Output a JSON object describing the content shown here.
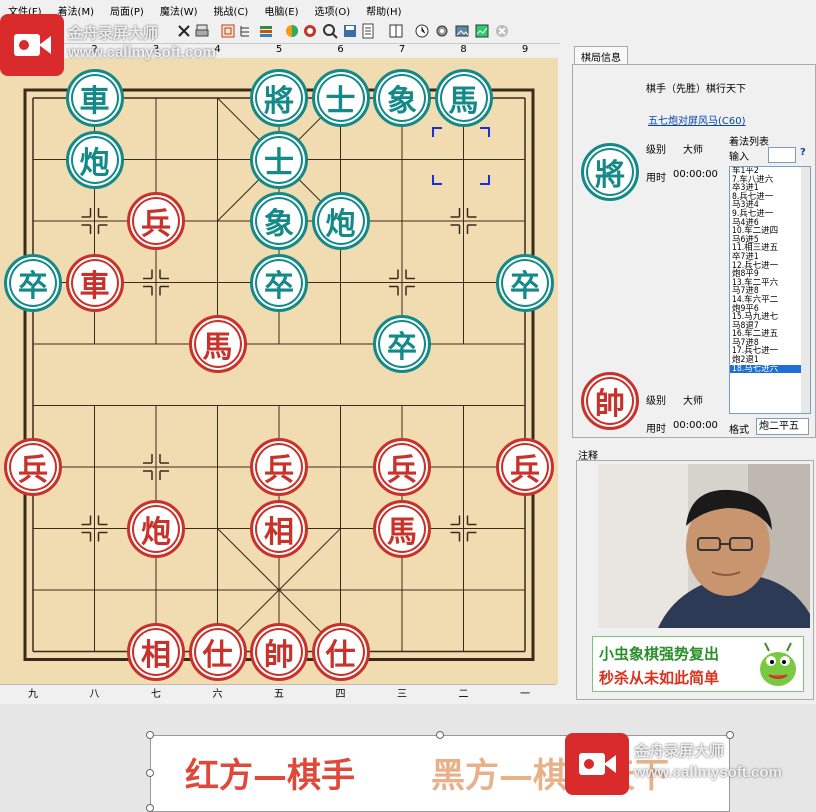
{
  "menubar": {
    "items": [
      "文件(F)",
      "着法(M)",
      "局面(P)",
      "魔法(W)",
      "挑战(C)",
      "电脑(E)",
      "选项(O)",
      "帮助(H)"
    ]
  },
  "watermark": {
    "title": "金舟录屏大师",
    "url": "www.callmysoft.com"
  },
  "board": {
    "top_coords": [
      "1",
      "2",
      "3",
      "4",
      "5",
      "6",
      "7",
      "8",
      "9"
    ],
    "bottom_coords": [
      "九",
      "八",
      "七",
      "六",
      "五",
      "四",
      "三",
      "二",
      "一"
    ],
    "colors": {
      "board": "#f1dbb0",
      "black": "#148a88",
      "red": "#c8322a",
      "select": "#1b2fd8"
    },
    "pieces": [
      {
        "name": "black-chariot-a",
        "char": "車",
        "side": "black",
        "col": 2,
        "row": 1
      },
      {
        "name": "black-general",
        "char": "將",
        "side": "black",
        "col": 5,
        "row": 1
      },
      {
        "name": "black-advisor-a",
        "char": "士",
        "side": "black",
        "col": 6,
        "row": 1
      },
      {
        "name": "black-elephant-a",
        "char": "象",
        "side": "black",
        "col": 7,
        "row": 1
      },
      {
        "name": "black-horse",
        "char": "馬",
        "side": "black",
        "col": 8,
        "row": 1
      },
      {
        "name": "black-cannon-a",
        "char": "炮",
        "side": "black",
        "col": 2,
        "row": 2
      },
      {
        "name": "black-advisor-b",
        "char": "士",
        "side": "black",
        "col": 5,
        "row": 2
      },
      {
        "name": "red-soldier-a",
        "char": "兵",
        "side": "red",
        "col": 3,
        "row": 3
      },
      {
        "name": "black-elephant-b",
        "char": "象",
        "side": "black",
        "col": 5,
        "row": 3
      },
      {
        "name": "black-cannon-b",
        "char": "炮",
        "side": "black",
        "col": 6,
        "row": 3
      },
      {
        "name": "black-soldier-a",
        "char": "卒",
        "side": "black",
        "col": 1,
        "row": 4
      },
      {
        "name": "red-chariot",
        "char": "車",
        "side": "red",
        "col": 2,
        "row": 4
      },
      {
        "name": "black-soldier-b",
        "char": "卒",
        "side": "black",
        "col": 5,
        "row": 4
      },
      {
        "name": "black-soldier-c",
        "char": "卒",
        "side": "black",
        "col": 9,
        "row": 4
      },
      {
        "name": "red-horse-a",
        "char": "馬",
        "side": "red",
        "col": 4,
        "row": 5
      },
      {
        "name": "black-soldier-d",
        "char": "卒",
        "side": "black",
        "col": 7,
        "row": 5
      },
      {
        "name": "red-soldier-b",
        "char": "兵",
        "side": "red",
        "col": 1,
        "row": 7
      },
      {
        "name": "red-soldier-c",
        "char": "兵",
        "side": "red",
        "col": 5,
        "row": 7
      },
      {
        "name": "red-soldier-d",
        "char": "兵",
        "side": "red",
        "col": 7,
        "row": 7
      },
      {
        "name": "red-soldier-e",
        "char": "兵",
        "side": "red",
        "col": 9,
        "row": 7
      },
      {
        "name": "red-cannon",
        "char": "炮",
        "side": "red",
        "col": 3,
        "row": 8
      },
      {
        "name": "red-elephant-a",
        "char": "相",
        "side": "red",
        "col": 5,
        "row": 8
      },
      {
        "name": "red-horse-b",
        "char": "馬",
        "side": "red",
        "col": 7,
        "row": 8
      },
      {
        "name": "red-elephant-b",
        "char": "相",
        "side": "red",
        "col": 3,
        "row": 10
      },
      {
        "name": "red-advisor-a",
        "char": "仕",
        "side": "red",
        "col": 4,
        "row": 10
      },
      {
        "name": "red-king",
        "char": "帥",
        "side": "red",
        "col": 5,
        "row": 10
      },
      {
        "name": "red-advisor-b",
        "char": "仕",
        "side": "red",
        "col": 6,
        "row": 10
      }
    ]
  },
  "panel": {
    "tab": "棋局信息",
    "players_line": "棋手（先胜）棋行天下",
    "opening_link": "五七炮对屏风马(C60)",
    "black_piece": "將",
    "red_piece": "帥",
    "level_label": "级别",
    "level_value": "大师",
    "time_label": "用时",
    "time_value": "00:00:00",
    "moves_title": "着法列表",
    "input_label": "输入",
    "help": "?",
    "moves": [
      "车1平2",
      "7.车八进六",
      "卒3进1",
      "8.兵七进一",
      "马3进4",
      "9.兵七进一",
      "马4进6",
      "10.车二进四",
      "马6进5",
      "11.相三进五",
      "卒7进1",
      "12.兵七进一",
      "炮8平9",
      "13.车二平六",
      "马7进8",
      "14.车六平二",
      "炮9平6",
      "15.马九进七",
      "马8退7",
      "16.车二进五",
      "马7进8",
      "17.兵七进一",
      "炮2退1",
      "18.马七进六"
    ],
    "format_label": "格式",
    "format_value": "炮二平五",
    "note_title": "注释",
    "banner_line1": "小虫象棋强势复出",
    "banner_line2": "秒杀从未如此简单"
  },
  "slide": {
    "red_text": "红方—棋手",
    "black_text": "黑方—棋行天下"
  }
}
